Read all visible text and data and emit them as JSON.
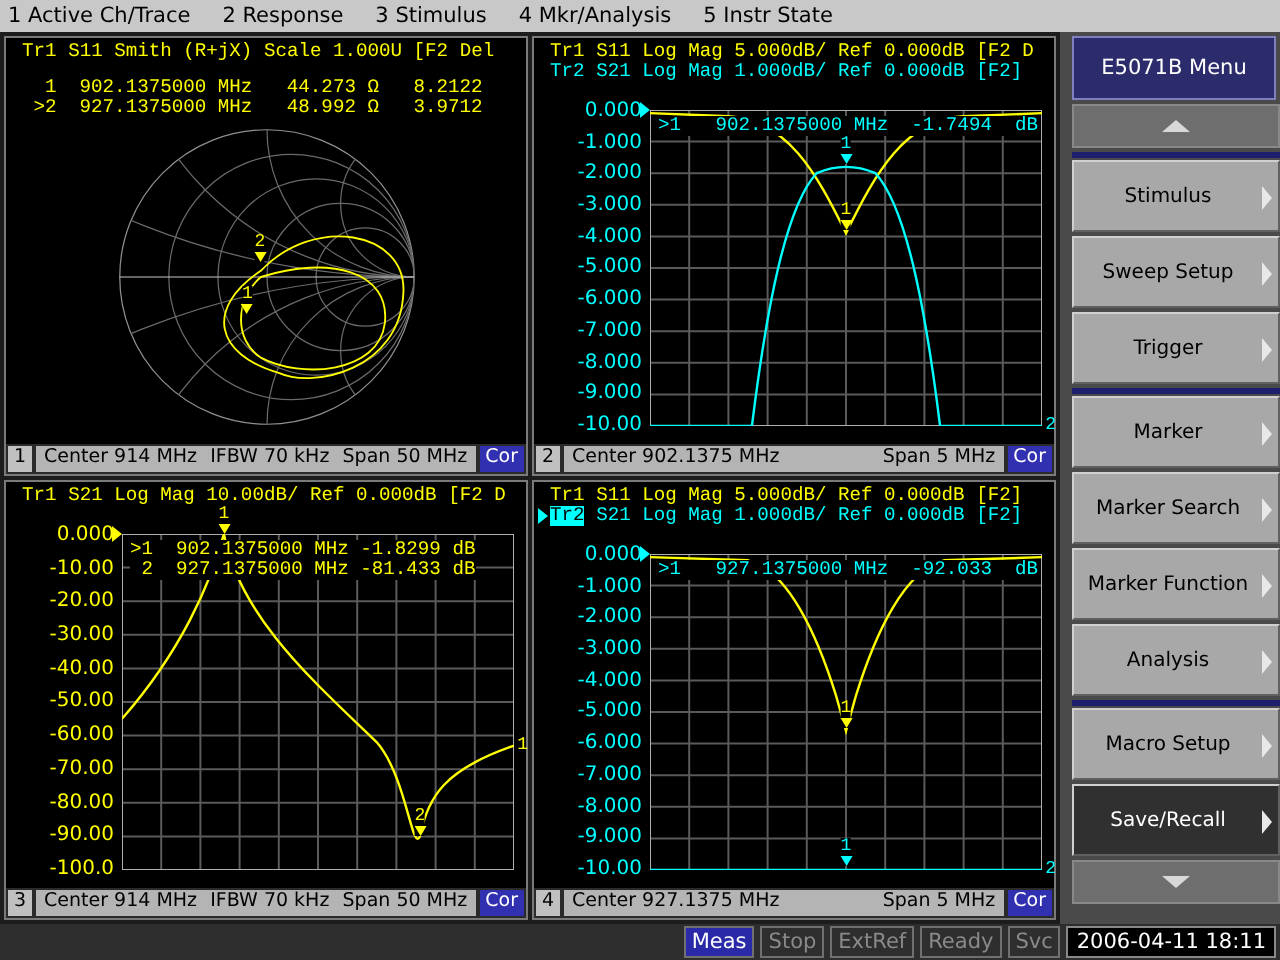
{
  "menu_bar": [
    "1 Active Ch/Trace",
    "2 Response",
    "3 Stimulus",
    "4 Mkr/Analysis",
    "5 Instr State"
  ],
  "channels": [
    {
      "kind": "smith",
      "traces": [
        {
          "name": "Tr1",
          "text": "S11 Smith (R+jX) Scale 1.000U [F2 Del",
          "color": "#ffff00",
          "selected": false
        }
      ],
      "readouts": [
        {
          "text": "  1  902.1375000 MHz   44.273 Ω   8.2122",
          "color": "#ffff00"
        },
        {
          "text": " >2  927.1375000 MHz   48.992 Ω   3.9712",
          "color": "#ffff00"
        }
      ],
      "markers": [
        {
          "label": "2",
          "color": "#ffff00"
        },
        {
          "label": "1",
          "color": "#ffff00"
        }
      ],
      "footer": {
        "number": "1",
        "fields": [
          "Center 914 MHz",
          "IFBW 70 kHz",
          "Span 50 MHz"
        ],
        "badge": "Cor"
      }
    },
    {
      "kind": "logmag",
      "traces": [
        {
          "name": "Tr1",
          "text": "S11 Log Mag 5.000dB/ Ref 0.000dB [F2 D",
          "color": "#ffff00",
          "selected": false
        },
        {
          "name": "Tr2",
          "text": "S21 Log Mag 1.000dB/ Ref 0.000dB [F2]",
          "color": "#00ffff",
          "selected": false
        }
      ],
      "y_labels": [
        "0.000",
        "-1.000",
        "-2.000",
        "-3.000",
        "-4.000",
        "-5.000",
        "-6.000",
        "-7.000",
        "-8.000",
        "-9.000",
        "-10.00"
      ],
      "readouts": [
        {
          "text": ">1   902.1375000 MHz  -1.7494  dB",
          "color": "#00ffff"
        }
      ],
      "markers": [
        {
          "label": "1",
          "color": "#00ffff"
        },
        {
          "label": "1",
          "color": "#ffff00"
        }
      ],
      "end_label": {
        "text": "2",
        "color": "#00ffff"
      },
      "footer": {
        "number": "2",
        "fields": [
          "Center 902.1375 MHz",
          "Span 5 MHz"
        ],
        "badge": "Cor"
      }
    },
    {
      "kind": "logmag",
      "traces": [
        {
          "name": "Tr1",
          "text": "S21 Log Mag 10.00dB/ Ref 0.000dB [F2 D",
          "color": "#ffff00",
          "selected": false
        }
      ],
      "y_labels": [
        "0.000",
        "-10.00",
        "-20.00",
        "-30.00",
        "-40.00",
        "-50.00",
        "-60.00",
        "-70.00",
        "-80.00",
        "-90.00",
        "-100.0"
      ],
      "readouts": [
        {
          "text": ">1  902.1375000 MHz -1.8299 dB",
          "color": "#ffff00"
        },
        {
          "text": " 2  927.1375000 MHz -81.433 dB",
          "color": "#ffff00"
        }
      ],
      "markers": [
        {
          "label": "1",
          "color": "#ffff00"
        },
        {
          "label": "2",
          "color": "#ffff00"
        }
      ],
      "end_label": {
        "text": "1",
        "color": "#ffff00"
      },
      "footer": {
        "number": "3",
        "fields": [
          "Center 914 MHz",
          "IFBW 70 kHz",
          "Span 50 MHz"
        ],
        "badge": "Cor"
      }
    },
    {
      "kind": "logmag",
      "traces": [
        {
          "name": "Tr1",
          "text": "S11 Log Mag 5.000dB/ Ref 0.000dB [F2]",
          "color": "#ffff00",
          "selected": false
        },
        {
          "name": "Tr2",
          "text": "S21 Log Mag 1.000dB/ Ref 0.000dB [F2]",
          "color": "#00ffff",
          "selected": true
        }
      ],
      "y_labels": [
        "0.000",
        "-1.000",
        "-2.000",
        "-3.000",
        "-4.000",
        "-5.000",
        "-6.000",
        "-7.000",
        "-8.000",
        "-9.000",
        "-10.00"
      ],
      "readouts": [
        {
          "text": ">1   927.1375000 MHz  -92.033  dB",
          "color": "#00ffff"
        }
      ],
      "markers": [
        {
          "label": "1",
          "color": "#ffff00"
        },
        {
          "label": "1",
          "color": "#00ffff"
        }
      ],
      "end_label": {
        "text": "2",
        "color": "#00ffff"
      },
      "footer": {
        "number": "4",
        "fields": [
          "Center 927.1375 MHz",
          "Span 5 MHz"
        ],
        "badge": "Cor"
      }
    }
  ],
  "softkeys": {
    "title": "E5071B Menu",
    "groups": [
      {
        "items": [
          {
            "label": "Stimulus",
            "selected": false
          },
          {
            "label": "Sweep Setup",
            "selected": false
          },
          {
            "label": "Trigger",
            "selected": false
          }
        ]
      },
      {
        "items": [
          {
            "label": "Marker",
            "selected": false
          },
          {
            "label": "Marker Search",
            "selected": false
          },
          {
            "label": "Marker Function",
            "selected": false
          },
          {
            "label": "Analysis",
            "selected": false
          }
        ]
      },
      {
        "items": [
          {
            "label": "Macro Setup",
            "selected": false
          },
          {
            "label": "Save/Recall",
            "selected": true
          }
        ]
      }
    ]
  },
  "status_bar": {
    "items": [
      {
        "label": "Meas",
        "on": true
      },
      {
        "label": "Stop",
        "on": false
      },
      {
        "label": "ExtRef",
        "on": false
      },
      {
        "label": "Ready",
        "on": false
      },
      {
        "label": "Svc",
        "on": false
      }
    ],
    "datetime": "2006-04-11 18:11"
  }
}
